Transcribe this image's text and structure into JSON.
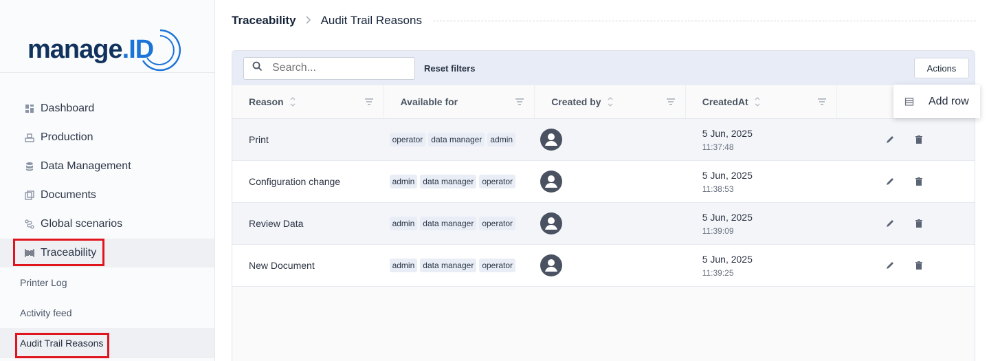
{
  "sidebar": {
    "logo_text": "manage",
    "logo_dot": ".",
    "logo_id": "ID",
    "nav": [
      {
        "label": "Dashboard",
        "icon": "dashboard-icon"
      },
      {
        "label": "Production",
        "icon": "production-icon"
      },
      {
        "label": "Data Management",
        "icon": "database-icon"
      },
      {
        "label": "Documents",
        "icon": "documents-icon"
      },
      {
        "label": "Global scenarios",
        "icon": "scenarios-icon"
      },
      {
        "label": "Traceability",
        "icon": "barcode-icon"
      }
    ],
    "sub_items": [
      "Printer Log",
      "Activity feed",
      "Audit Trail Reasons"
    ]
  },
  "breadcrumb": {
    "root": "Traceability",
    "separator": ">",
    "current": "Audit Trail Reasons"
  },
  "toolbar": {
    "search_placeholder": "Search...",
    "reset_label": "Reset filters",
    "actions_label": "Actions"
  },
  "table": {
    "columns": [
      "Reason",
      "Available for",
      "Created by",
      "CreatedAt"
    ],
    "rows": [
      {
        "reason": "Print",
        "roles": [
          "operator",
          "data manager",
          "admin"
        ],
        "date": "5 Jun, 2025",
        "time": "11:37:48"
      },
      {
        "reason": "Configuration change",
        "roles": [
          "admin",
          "data manager",
          "operator"
        ],
        "date": "5 Jun, 2025",
        "time": "11:38:53"
      },
      {
        "reason": "Review Data",
        "roles": [
          "admin",
          "data manager",
          "operator"
        ],
        "date": "5 Jun, 2025",
        "time": "11:39:09"
      },
      {
        "reason": "New Document",
        "roles": [
          "admin",
          "data manager",
          "operator"
        ],
        "date": "5 Jun, 2025",
        "time": "11:39:25"
      }
    ]
  },
  "dropdown": {
    "add_row_label": "Add row"
  },
  "colors": {
    "accent": "#1b74d8",
    "brand_dark": "#10325c",
    "highlight": "#e0141c"
  }
}
